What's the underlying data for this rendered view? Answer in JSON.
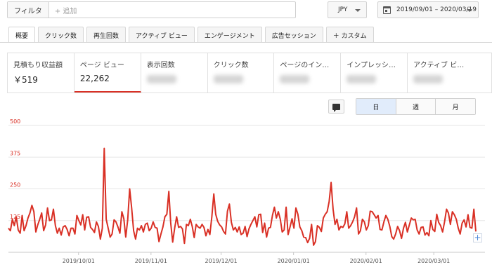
{
  "filter": {
    "label": "フィルタ",
    "placeholder": "+ 追加"
  },
  "currency": {
    "value": "JPY"
  },
  "date_range": {
    "value": "2019/09/01 – 2020/03/19"
  },
  "tabs": [
    {
      "label": "概要",
      "active": true
    },
    {
      "label": "クリック数"
    },
    {
      "label": "再生回数"
    },
    {
      "label": "アクティブ ビュー"
    },
    {
      "label": "エンゲージメント"
    },
    {
      "label": "広告セッション"
    },
    {
      "label": "＋ カスタム"
    }
  ],
  "metrics": [
    {
      "label": "見積もり収益額",
      "value": "￥519"
    },
    {
      "label": "ページ ビュー",
      "value": "22,262",
      "active": true
    },
    {
      "label": "表示回数",
      "value": ""
    },
    {
      "label": "クリック数",
      "value": ""
    },
    {
      "label": "ページのイン…",
      "value": ""
    },
    {
      "label": "インプレッシ…",
      "value": ""
    },
    {
      "label": "アクティブ ビ…",
      "value": ""
    }
  ],
  "granularity": {
    "day": "日",
    "week": "週",
    "month": "月"
  },
  "colors": {
    "line": "#d93025",
    "accent": "#d93025",
    "active_segment": "#e1ecfb"
  },
  "icons": {
    "annotation": "comment-icon",
    "calendar": "calendar-icon",
    "add": "plus-icon"
  },
  "chart_data": {
    "type": "line",
    "ylim": [
      0,
      500
    ],
    "yticks": [
      125,
      250,
      375,
      500
    ],
    "grid": true,
    "x_start": "2019-09-01",
    "x_end": "2020-03-19",
    "xtick_labels": [
      "2019/10/01",
      "2019/11/01",
      "2019/12/01",
      "2020/01/01",
      "2020/02/01",
      "2020/03/01"
    ],
    "series": [
      {
        "values": [
          95,
          85,
          130,
          105,
          140,
          88,
          75,
          145,
          85,
          105,
          135,
          155,
          185,
          160,
          80,
          108,
          130,
          155,
          85,
          108,
          175,
          125,
          128,
          170,
          105,
          75,
          95,
          68,
          100,
          105,
          90,
          65,
          95,
          95,
          72,
          145,
          125,
          108,
          148,
          88,
          138,
          140,
          98,
          90,
          78,
          120,
          102,
          52,
          95,
          410,
          130,
          95,
          60,
          72,
          128,
          120,
          100,
          75,
          160,
          132,
          60,
          128,
          250,
          175,
          85,
          52,
          95,
          88,
          105,
          80,
          110,
          115,
          85,
          95,
          120,
          98,
          95,
          42,
          72,
          100,
          140,
          150,
          240,
          115,
          40,
          95,
          140,
          98,
          102,
          92,
          35,
          110,
          105,
          130,
          102,
          58,
          110,
          100,
          95,
          110,
          98,
          65,
          90,
          70,
          140,
          230,
          150,
          122,
          108,
          100,
          82,
          72,
          162,
          190,
          118,
          88,
          98,
          80,
          100,
          70,
          75,
          102,
          62,
          92,
          110,
          125,
          140,
          100,
          148,
          150,
          78,
          115,
          60,
          95,
          98,
          145,
          178,
          135,
          160,
          130,
          80,
          88,
          178,
          70,
          100,
          132,
          95,
          175,
          150,
          100,
          85,
          60,
          58,
          38,
          55,
          110,
          28,
          42,
          105,
          98,
          82,
          135,
          150,
          160,
          200,
          275,
          170,
          110,
          130,
          88,
          102,
          98,
          112,
          160,
          95,
          105,
          120,
          140,
          175,
          72,
          85,
          130,
          120,
          88,
          105,
          162,
          160,
          148,
          135,
          145,
          90,
          88,
          120,
          145,
          130,
          102,
          62,
          52,
          72,
          102,
          85,
          55,
          95,
          118,
          80,
          108,
          135,
          128,
          130,
          88,
          72,
          98,
          100,
          68,
          78,
          65,
          125,
          90,
          82,
          150,
          118,
          105,
          80,
          120,
          170,
          155,
          110,
          160,
          148,
          130,
          95,
          72,
          115,
          128,
          100,
          148,
          98,
          95,
          170,
          82
        ]
      }
    ]
  }
}
